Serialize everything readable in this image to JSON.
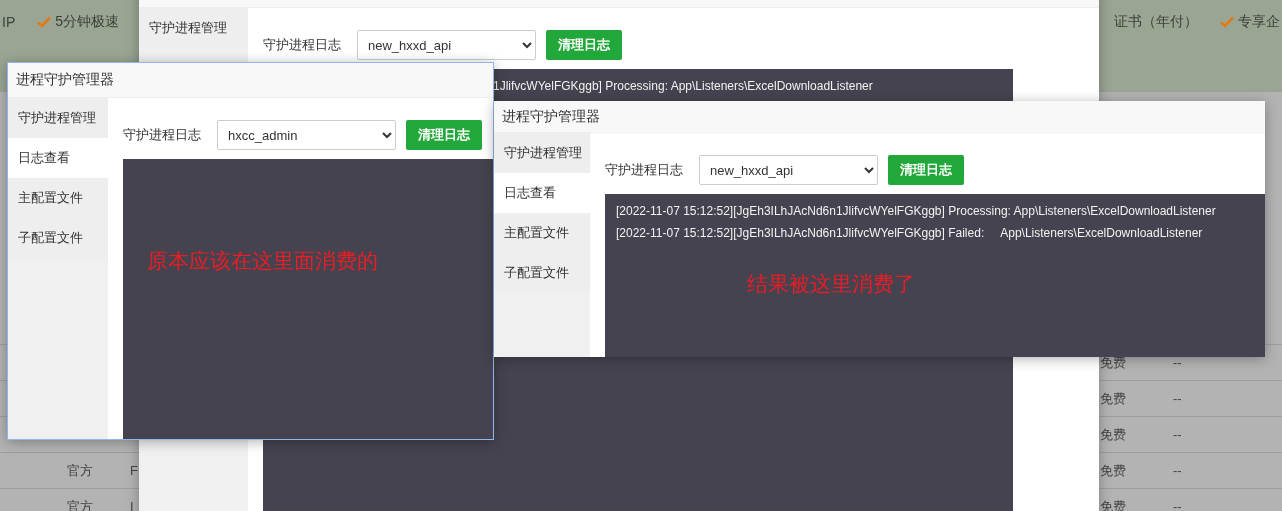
{
  "background_page": {
    "banner_left": [
      {
        "label": "IP",
        "checked": false
      },
      {
        "label": "5分钟极速",
        "checked": true
      }
    ],
    "banner_right": [
      {
        "label": "证书（年付）",
        "checked": false
      },
      {
        "label": "专享企",
        "checked": true
      }
    ],
    "table_rows": [
      {
        "column_4": "免费",
        "column_5": "--"
      },
      {
        "column_4": "免费",
        "column_5": "--"
      },
      {
        "column_4": "免费",
        "column_5": "--"
      },
      {
        "column_2": "官方",
        "column_3": "F",
        "column_4": "免费",
        "column_5": "--"
      },
      {
        "column_2": "官方",
        "column_3": "I",
        "column_4": "免费",
        "column_5": "--"
      }
    ]
  },
  "windows": [
    {
      "kind": "back",
      "sidebar": [
        {
          "label": "守护进程管理",
          "selected": false
        }
      ],
      "log_label": "守护进程日志",
      "select_value": "new_hxxd_api",
      "button": "清理日志",
      "log_lines": [
        "1JlifvcWYelFGKggb] Processing: App\\Listeners\\ExcelDownloadListener"
      ]
    },
    {
      "kind": "left",
      "title": "进程守护管理器",
      "sidebar": [
        {
          "label": "守护进程管理",
          "selected": false
        },
        {
          "label": "日志查看",
          "selected": true
        },
        {
          "label": "主配置文件",
          "selected": false
        },
        {
          "label": "子配置文件",
          "selected": false
        }
      ],
      "log_label": "守护进程日志",
      "select_value": "hxcc_admin",
      "button": "清理日志",
      "note": "原本应该在这里面消费的"
    },
    {
      "kind": "right",
      "title": "进程守护管理器",
      "sidebar": [
        {
          "label": "守护进程管理",
          "selected": false
        },
        {
          "label": "日志查看",
          "selected": true
        },
        {
          "label": "主配置文件",
          "selected": false
        },
        {
          "label": "子配置文件",
          "selected": false
        }
      ],
      "log_label": "守护进程日志",
      "select_value": "new_hxxd_api",
      "button": "清理日志",
      "log_lines": [
        "[2022-11-07 15:12:52][JgEh3ILhJAcNd6n1JlifvcWYelFGKggb] Processing: App\\Listeners\\ExcelDownloadListener",
        "[2022-11-07 15:12:52][JgEh3ILhJAcNd6n1JlifvcWYelFGKggb] Failed:     App\\Listeners\\ExcelDownloadListener"
      ],
      "note": "结果被这里消费了"
    }
  ]
}
